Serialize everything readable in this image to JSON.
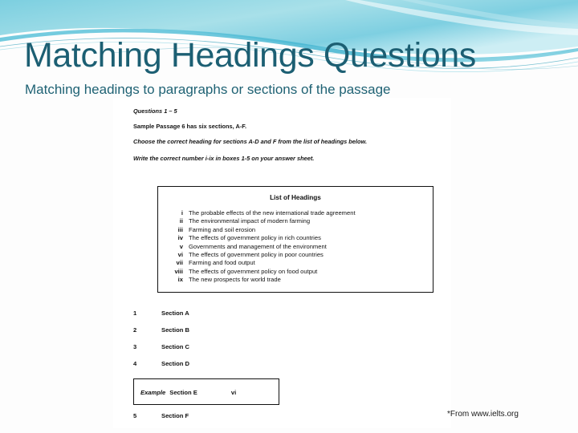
{
  "slide": {
    "title": "Matching Headings Questions",
    "subtitle": "Matching headings to paragraphs or sections of the passage",
    "attribution": "*From www.ielts.org",
    "colors": {
      "title_text": "#1c5f73",
      "subtitle_text": "#1f6274",
      "banner_cyan": "#7ed0e0",
      "banner_teal": "#2ea3bd",
      "background": "#fdfdfd",
      "document_background": "#ffffff"
    }
  },
  "document": {
    "instructions": [
      "Questions 1 – 5",
      "Sample Passage 6 has six sections, A-F.",
      "Choose the correct heading for sections A-D and F from the list of headings below.",
      "Write the correct number i-ix in boxes 1-5 on your answer sheet."
    ],
    "headings_box": {
      "title": "List of Headings",
      "items": [
        {
          "numeral": "i",
          "text": "The probable effects of the new international trade agreement"
        },
        {
          "numeral": "ii",
          "text": "The environmental impact of modern farming"
        },
        {
          "numeral": "iii",
          "text": "Farming and soil erosion"
        },
        {
          "numeral": "iv",
          "text": "The effects of government policy in rich countries"
        },
        {
          "numeral": "v",
          "text": "Governments and management of the environment"
        },
        {
          "numeral": "vi",
          "text": "The effects of government policy in poor countries"
        },
        {
          "numeral": "vii",
          "text": "Farming and food output"
        },
        {
          "numeral": "viii",
          "text": "The effects of government policy on food output"
        },
        {
          "numeral": "ix",
          "text": "The new prospects for world trade"
        }
      ]
    },
    "section_rows": [
      {
        "number": "1",
        "label": "Section A"
      },
      {
        "number": "2",
        "label": "Section B"
      },
      {
        "number": "3",
        "label": "Section C"
      },
      {
        "number": "4",
        "label": "Section D"
      }
    ],
    "example": {
      "word": "Example",
      "section": "Section E",
      "answer": "vi"
    },
    "final_row": {
      "number": "5",
      "label": "Section F"
    }
  }
}
